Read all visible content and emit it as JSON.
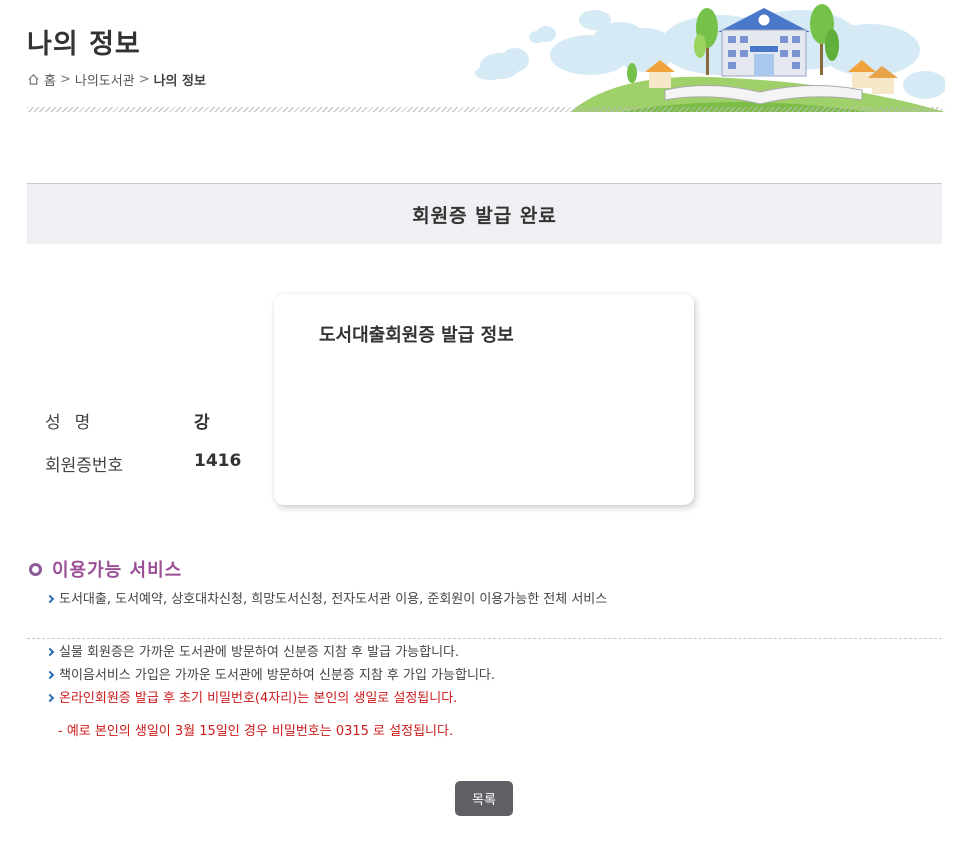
{
  "header": {
    "title": "나의 정보",
    "breadcrumb": {
      "home": "홈",
      "sep1": ">",
      "parent": "나의도서관",
      "sep2": ">",
      "current": "나의 정보"
    }
  },
  "banner": {
    "title": "회원증 발급 완료"
  },
  "card": {
    "title": "도서대출회원증 발급 정보",
    "rows": [
      {
        "label": "성명",
        "value": "강"
      },
      {
        "label": "회원증번호",
        "value": "1416"
      }
    ]
  },
  "services": {
    "heading": "이용가능 서비스",
    "items": [
      "도서대출, 도서예약, 상호대차신청, 희망도서신청, 전자도서관 이용, 준회원이 이용가능한 전체 서비스"
    ]
  },
  "notices": {
    "items": [
      {
        "text": "실물 회원증은 가까운 도서관에 방문하여 신분증 지참 후 발급 가능합니다.",
        "highlight": false
      },
      {
        "text": "책이음서비스 가입은 가까운 도서관에 방문하여 신분증 지참 후 가입 가능합니다.",
        "highlight": false
      },
      {
        "text": "온라인회원증 발급 후 초기 비밀번호(4자리)는 본인의 생일로 설정됩니다.",
        "highlight": true
      }
    ],
    "example": "- 예로 본인의 생일이 3월 15일인 경우 비밀번호는 0315 로 설정됩니다."
  },
  "actions": {
    "list_label": "목록"
  },
  "colors": {
    "accent": "#9b4f96",
    "bullet": "#2b6bb2",
    "warning": "#cc1b1b",
    "button": "#5f5f65",
    "banner_bg": "#eff0f3"
  },
  "icons": {
    "home": "home-icon",
    "section": "ring-icon",
    "illustration": "library-building-illustration"
  }
}
